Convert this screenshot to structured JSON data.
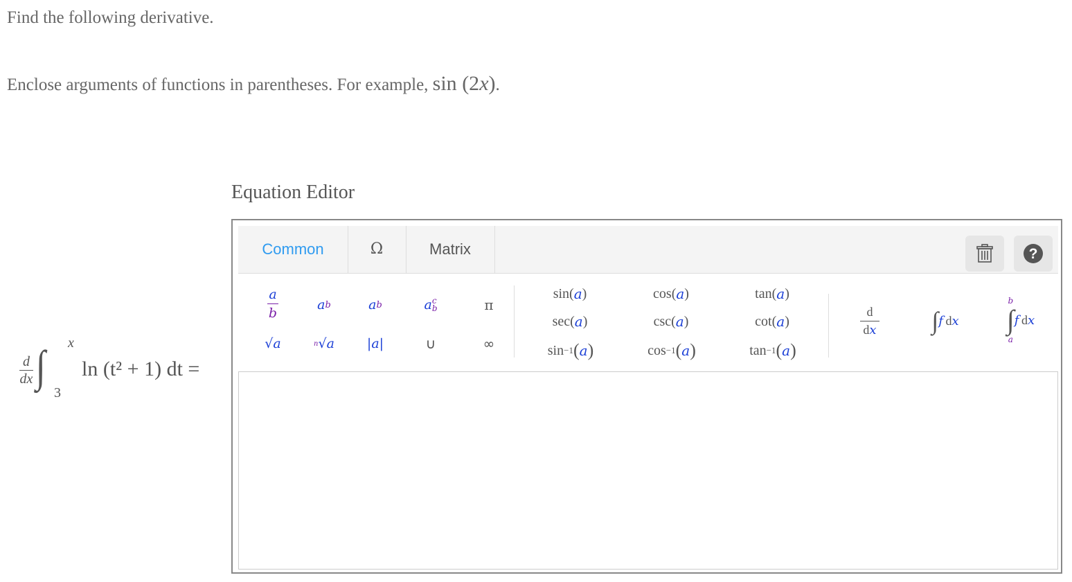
{
  "prompt": {
    "line1": "Find the following derivative.",
    "line2_prefix": "Enclose arguments of functions in parentheses. For example, ",
    "example_fn": "sin",
    "example_arg_open": " (2",
    "example_arg_var": "x",
    "example_arg_close": ")",
    "line2_suffix": "."
  },
  "expression": {
    "d_num": "d",
    "d_den": "dx",
    "integral_sign": "∫",
    "upper_limit": "x",
    "lower_limit": "3",
    "integrand": "ln (t² + 1) dt ="
  },
  "editor": {
    "title": "Equation Editor",
    "tabs": [
      {
        "label": "Common",
        "active": true
      },
      {
        "label": "Ω",
        "active": false
      },
      {
        "label": "Matrix",
        "active": false
      }
    ],
    "trash_label": "clear",
    "help_label": "?",
    "palette": {
      "frac_num": "a",
      "frac_den": "b",
      "power_base": "a",
      "power_exp": "b",
      "sub_base": "a",
      "sub_sub": "b",
      "subsup_base": "a",
      "subsup_sup": "c",
      "subsup_sub": "b",
      "pi": "π",
      "sqrt": "√a",
      "nroot_index": "n",
      "nroot": "√a",
      "abs": "|a|",
      "union": "∪",
      "infinity": "∞",
      "trig": [
        "sin",
        "cos",
        "tan",
        "sec",
        "csc",
        "cot"
      ],
      "inv_trig": [
        "sin",
        "cos",
        "tan"
      ],
      "inv_exp": "−1",
      "arg": "a",
      "deriv_num": "d",
      "deriv_den_d": "d",
      "deriv_den_x": "x",
      "int_sign": "∫",
      "int_f": "f",
      "int_d": "d",
      "int_x": "x",
      "defint_upper": "b",
      "defint_lower": "a"
    },
    "answer_value": "",
    "colors": {
      "accent": "#2f9bf0",
      "var_blue": "#1b3fd6",
      "var_purple": "#7a1fa8"
    }
  }
}
